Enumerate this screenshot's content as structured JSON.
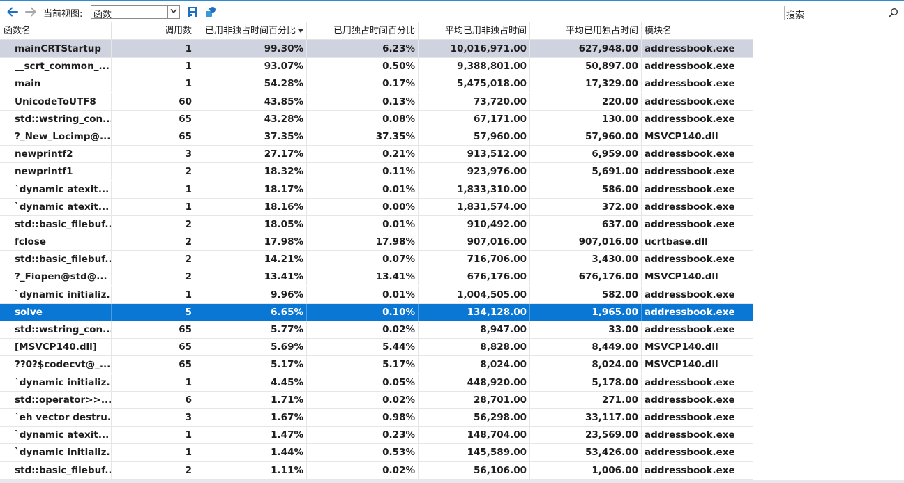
{
  "toolbar": {
    "back_icon": "back-arrow-icon",
    "forward_icon": "forward-arrow-icon",
    "view_label": "当前视图:",
    "view_value": "函数",
    "save_icon": "save-icon",
    "export_icon": "export-icon",
    "search_placeholder": "搜索"
  },
  "colors": {
    "accent": "#2e8bd6",
    "selection_blue": "#0a77d4",
    "selection_gray": "#cfd3e0"
  },
  "table": {
    "columns": [
      "函数名",
      "调用数",
      "已用非独占时间百分比",
      "已用独占时间百分比",
      "平均已用非独占时间",
      "平均已用独占时间",
      "模块名"
    ],
    "sort_column": "已用非独占时间百分比",
    "sort_direction": "descending",
    "rows": [
      [
        "mainCRTStartup",
        "1",
        "99.30%",
        "6.23%",
        "10,016,971.00",
        "627,948.00",
        "addressbook.exe"
      ],
      [
        "__scrt_common_...",
        "1",
        "93.07%",
        "0.50%",
        "9,388,801.00",
        "50,897.00",
        "addressbook.exe"
      ],
      [
        "main",
        "1",
        "54.28%",
        "0.17%",
        "5,475,018.00",
        "17,329.00",
        "addressbook.exe"
      ],
      [
        "UnicodeToUTF8",
        "60",
        "43.85%",
        "0.13%",
        "73,720.00",
        "220.00",
        "addressbook.exe"
      ],
      [
        "std::wstring_con...",
        "65",
        "43.28%",
        "0.08%",
        "67,171.00",
        "130.00",
        "addressbook.exe"
      ],
      [
        "?_New_Locimp@...",
        "65",
        "37.35%",
        "37.35%",
        "57,960.00",
        "57,960.00",
        "MSVCP140.dll"
      ],
      [
        "newprintf2",
        "3",
        "27.17%",
        "0.21%",
        "913,512.00",
        "6,959.00",
        "addressbook.exe"
      ],
      [
        "newprintf1",
        "2",
        "18.32%",
        "0.11%",
        "923,976.00",
        "5,691.00",
        "addressbook.exe"
      ],
      [
        "`dynamic atexit...",
        "1",
        "18.17%",
        "0.01%",
        "1,833,310.00",
        "586.00",
        "addressbook.exe"
      ],
      [
        "`dynamic atexit...",
        "1",
        "18.16%",
        "0.00%",
        "1,831,574.00",
        "372.00",
        "addressbook.exe"
      ],
      [
        "std::basic_filebuf...",
        "2",
        "18.05%",
        "0.01%",
        "910,492.00",
        "637.00",
        "addressbook.exe"
      ],
      [
        "fclose",
        "2",
        "17.98%",
        "17.98%",
        "907,016.00",
        "907,016.00",
        "ucrtbase.dll"
      ],
      [
        "std::basic_filebuf...",
        "2",
        "14.21%",
        "0.07%",
        "716,706.00",
        "3,430.00",
        "addressbook.exe"
      ],
      [
        "?_Fiopen@std@...",
        "2",
        "13.41%",
        "13.41%",
        "676,176.00",
        "676,176.00",
        "MSVCP140.dll"
      ],
      [
        "`dynamic initializ...",
        "1",
        "9.96%",
        "0.01%",
        "1,004,505.00",
        "582.00",
        "addressbook.exe"
      ],
      [
        "solve",
        "5",
        "6.65%",
        "0.10%",
        "134,128.00",
        "1,965.00",
        "addressbook.exe"
      ],
      [
        "std::wstring_con...",
        "65",
        "5.77%",
        "0.02%",
        "8,947.00",
        "33.00",
        "addressbook.exe"
      ],
      [
        "[MSVCP140.dll]",
        "65",
        "5.69%",
        "5.44%",
        "8,828.00",
        "8,449.00",
        "MSVCP140.dll"
      ],
      [
        "??0?$codecvt@_...",
        "65",
        "5.17%",
        "5.17%",
        "8,024.00",
        "8,024.00",
        "MSVCP140.dll"
      ],
      [
        "`dynamic initializ...",
        "1",
        "4.45%",
        "0.05%",
        "448,920.00",
        "5,178.00",
        "addressbook.exe"
      ],
      [
        "std::operator>>...",
        "6",
        "1.71%",
        "0.02%",
        "28,701.00",
        "271.00",
        "addressbook.exe"
      ],
      [
        "`eh vector destru...",
        "3",
        "1.67%",
        "0.98%",
        "56,298.00",
        "33,117.00",
        "addressbook.exe"
      ],
      [
        "`dynamic atexit...",
        "1",
        "1.47%",
        "0.23%",
        "148,704.00",
        "23,569.00",
        "addressbook.exe"
      ],
      [
        "`dynamic initializ...",
        "1",
        "1.44%",
        "0.53%",
        "145,589.00",
        "53,426.00",
        "addressbook.exe"
      ],
      [
        "std::basic_filebuf...",
        "2",
        "1.11%",
        "0.02%",
        "56,106.00",
        "1,006.00",
        "addressbook.exe"
      ]
    ],
    "highlighted_row_index": 0,
    "selected_row_index": 15
  }
}
